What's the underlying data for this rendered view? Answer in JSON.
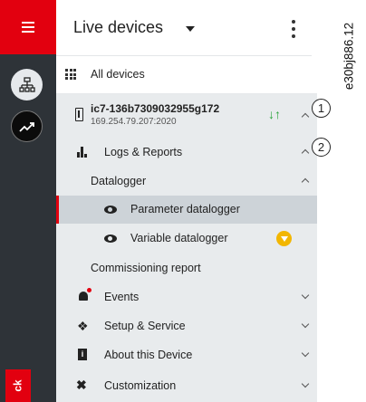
{
  "header": {
    "title": "Live devices"
  },
  "nav": {
    "all_devices": "All devices",
    "device": {
      "name": "ic7-136b7309032955g172",
      "ip": "169.254.79.207:2020"
    },
    "logs_reports": "Logs & Reports",
    "datalogger": "Datalogger",
    "parameter_datalogger": "Parameter datalogger",
    "variable_datalogger": "Variable datalogger",
    "commissioning_report": "Commissioning report",
    "events": "Events",
    "setup_service": "Setup & Service",
    "about_device": "About this Device",
    "customization": "Customization"
  },
  "rail": {
    "feedback_label": "ck"
  },
  "callouts": {
    "one": "1",
    "two": "2"
  },
  "doc_ref": "e30bj886.12",
  "icons": {
    "menu": "hamburger-icon",
    "devices": "network-icon",
    "live": "trend-icon",
    "grid": "grid-icon",
    "device": "drive-icon",
    "sync": "sync-arrows-icon",
    "logs": "bar-chart-icon",
    "eye": "eye-icon",
    "premium": "premium-badge-icon",
    "events": "bell-icon",
    "setup": "wrench-icon",
    "about": "info-icon",
    "custom": "tools-icon"
  },
  "colors": {
    "brand_red": "#e2000f",
    "rail_dark": "#2e3338",
    "sync_green": "#2aa33a",
    "premium_yellow": "#f2b600",
    "selected_row": "#cdd3d8"
  }
}
